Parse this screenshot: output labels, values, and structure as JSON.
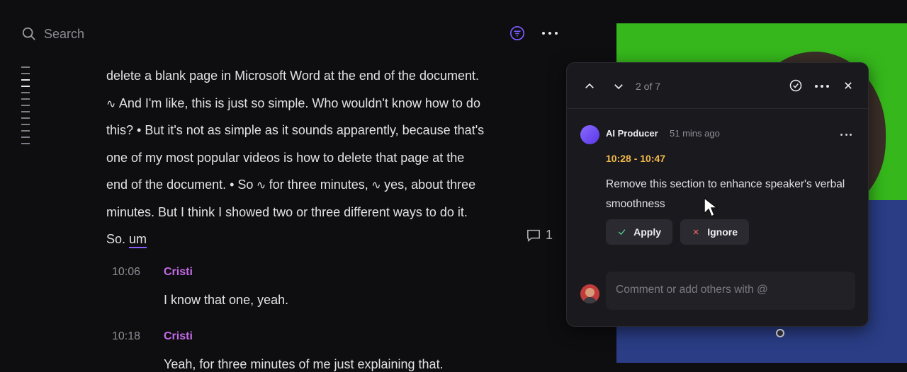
{
  "search": {
    "placeholder": "Search"
  },
  "transcript_lines": [
    "delete a blank page in Microsoft Word at the end of the document.",
    "And I'm like, this is just so simple. Who wouldn't know how to do",
    "this? • But it's not as simple as it sounds apparently, because that's",
    "one of my most popular videos is how to delete that page at the",
    "end of the document. • So",
    "for three minutes,",
    "yes, about three",
    "minutes. But I think I showed two or three different ways to do it.",
    "So.",
    "um"
  ],
  "comment_count": "1",
  "utterances": [
    {
      "time": "10:06",
      "speaker": "Cristi",
      "text": "I know that one, yeah."
    },
    {
      "time": "10:18",
      "speaker": "Cristi",
      "text": "Yeah, for three minutes of me just explaining that."
    }
  ],
  "popup": {
    "counter": "2 of 7",
    "author": "AI Producer",
    "time_ago": "51 mins ago",
    "range": "10:28 - 10:47",
    "text": "Remove this section to enhance speaker's verbal smoothness",
    "apply_label": "Apply",
    "ignore_label": "Ignore",
    "comment_placeholder": "Comment or add others with @"
  },
  "colors": {
    "accent": "#8a5cff",
    "speaker": "#c46ae6",
    "range": "#f2b84b",
    "green_screen": "#36b81c"
  },
  "icons": [
    "search-icon",
    "filter-icon",
    "more-icon",
    "wave-icon",
    "comment-icon",
    "chevron-up-icon",
    "chevron-down-icon",
    "check-circle-icon",
    "close-icon",
    "check-icon",
    "x-icon",
    "cursor-icon"
  ]
}
